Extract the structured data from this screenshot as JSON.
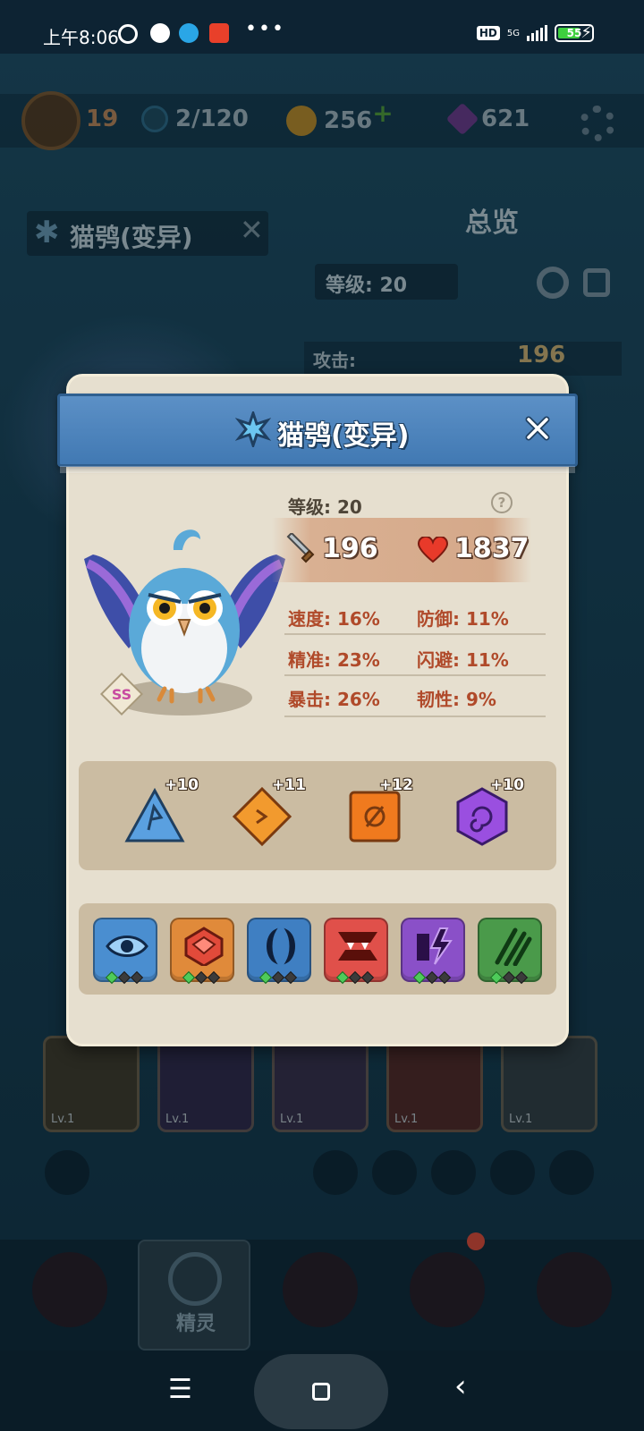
{
  "status_bar": {
    "time": "上午8:06",
    "dots": "•••",
    "hd": "HD",
    "network": "5G",
    "battery": "55"
  },
  "background": {
    "player_level": "19",
    "energy": "2/120",
    "coins": "256",
    "gems": "621",
    "creature_name": "猫鸮(变异)",
    "overview_label": "总览",
    "level_label": "等级: 20",
    "attack_label": "攻击:",
    "attack_value": "196",
    "card_levels": [
      "Lv.1",
      "Lv.1",
      "Lv.1",
      "Lv.1",
      "Lv.1"
    ],
    "nav_active_label": "精灵"
  },
  "modal": {
    "title": "猫鸮(变异)",
    "level_text": "等级: 20",
    "help_glyph": "?",
    "attack": "196",
    "hp": "1837",
    "grade": "SS",
    "stats": {
      "speed": "速度: 16%",
      "defense": "防御: 11%",
      "accuracy": "精准: 23%",
      "dodge": "闪避: 11%",
      "crit": "暴击: 26%",
      "tenacity": "韧性: 9%"
    },
    "runes": [
      {
        "icon": "blue-triangle-rune-icon",
        "plus": "+10",
        "color": "#5aa0e0"
      },
      {
        "icon": "orange-diamond-rune-icon",
        "plus": "+11",
        "color": "#f29a2e"
      },
      {
        "icon": "orange-square-rune-icon",
        "plus": "+12",
        "color": "#f07a1e"
      },
      {
        "icon": "purple-hexagon-rune-icon",
        "plus": "+10",
        "color": "#9a4fe0"
      }
    ],
    "skills": [
      {
        "icon": "eye-skill-icon",
        "color": "#4a8ed0",
        "level": 1
      },
      {
        "icon": "gem-skill-icon",
        "color": "#e08a3a",
        "level": 1
      },
      {
        "icon": "crescent-skill-icon",
        "color": "#3f7fc2",
        "level": 1
      },
      {
        "icon": "fang-skill-icon",
        "color": "#e0504a",
        "level": 1
      },
      {
        "icon": "lightning-skill-icon",
        "color": "#8a50c8",
        "level": 1
      },
      {
        "icon": "claw-skill-icon",
        "color": "#4a9a4a",
        "level": 1
      }
    ]
  }
}
